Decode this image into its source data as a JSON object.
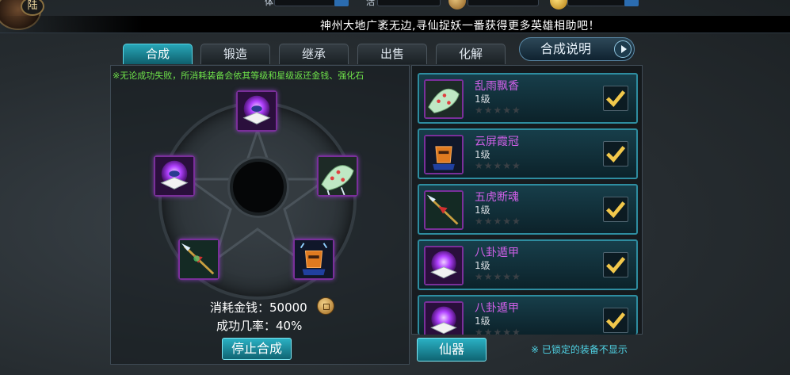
{
  "header": {
    "avatar_badge": "陆",
    "stat_labels": [
      "体",
      "活"
    ],
    "marquee": "神州大地广袤无边,寻仙捉妖一番获得更多英雄相助吧！"
  },
  "tabs": [
    {
      "label": "合成",
      "active": true
    },
    {
      "label": "锻造",
      "active": false
    },
    {
      "label": "继承",
      "active": false
    },
    {
      "label": "出售",
      "active": false
    },
    {
      "label": "化解",
      "active": false
    }
  ],
  "help_button": "合成说明",
  "synth": {
    "tip": "※无论成功失败，所消耗装备会依其等级和星级返还金钱、强化石",
    "cost_text": "消耗金钱：50000",
    "rate_text": "成功几率：40%",
    "stop_button": "停止合成",
    "slots": [
      "bagua-armor-icon",
      "bamboo-hat-icon",
      "orange-crown-icon",
      "spear-icon",
      "bagua-armor-icon"
    ]
  },
  "equipment_list": {
    "items": [
      {
        "name": "乱雨飘香",
        "level": "1级",
        "stars": "★★★★★",
        "checked": true,
        "icon": "bamboo-hat-icon"
      },
      {
        "name": "云屏霞冠",
        "level": "1级",
        "stars": "★★★★★",
        "checked": true,
        "icon": "orange-crown-icon"
      },
      {
        "name": "五虎断魂",
        "level": "1级",
        "stars": "★★★★★",
        "checked": true,
        "icon": "spear-icon"
      },
      {
        "name": "八卦遁甲",
        "level": "1级",
        "stars": "★★★★★",
        "checked": true,
        "icon": "bagua-armor-icon"
      },
      {
        "name": "八卦遁甲",
        "level": "1级",
        "stars": "★★★★★",
        "checked": true,
        "icon": "bagua-armor-icon"
      }
    ],
    "category_button": "仙器",
    "note": "※ 已锁定的装备不显示"
  },
  "colors": {
    "accent": "#2bb1c4",
    "item_name": "#d060e8",
    "tip": "#6fe34a",
    "note": "#4fd2e4",
    "check": "#f2c84b"
  }
}
